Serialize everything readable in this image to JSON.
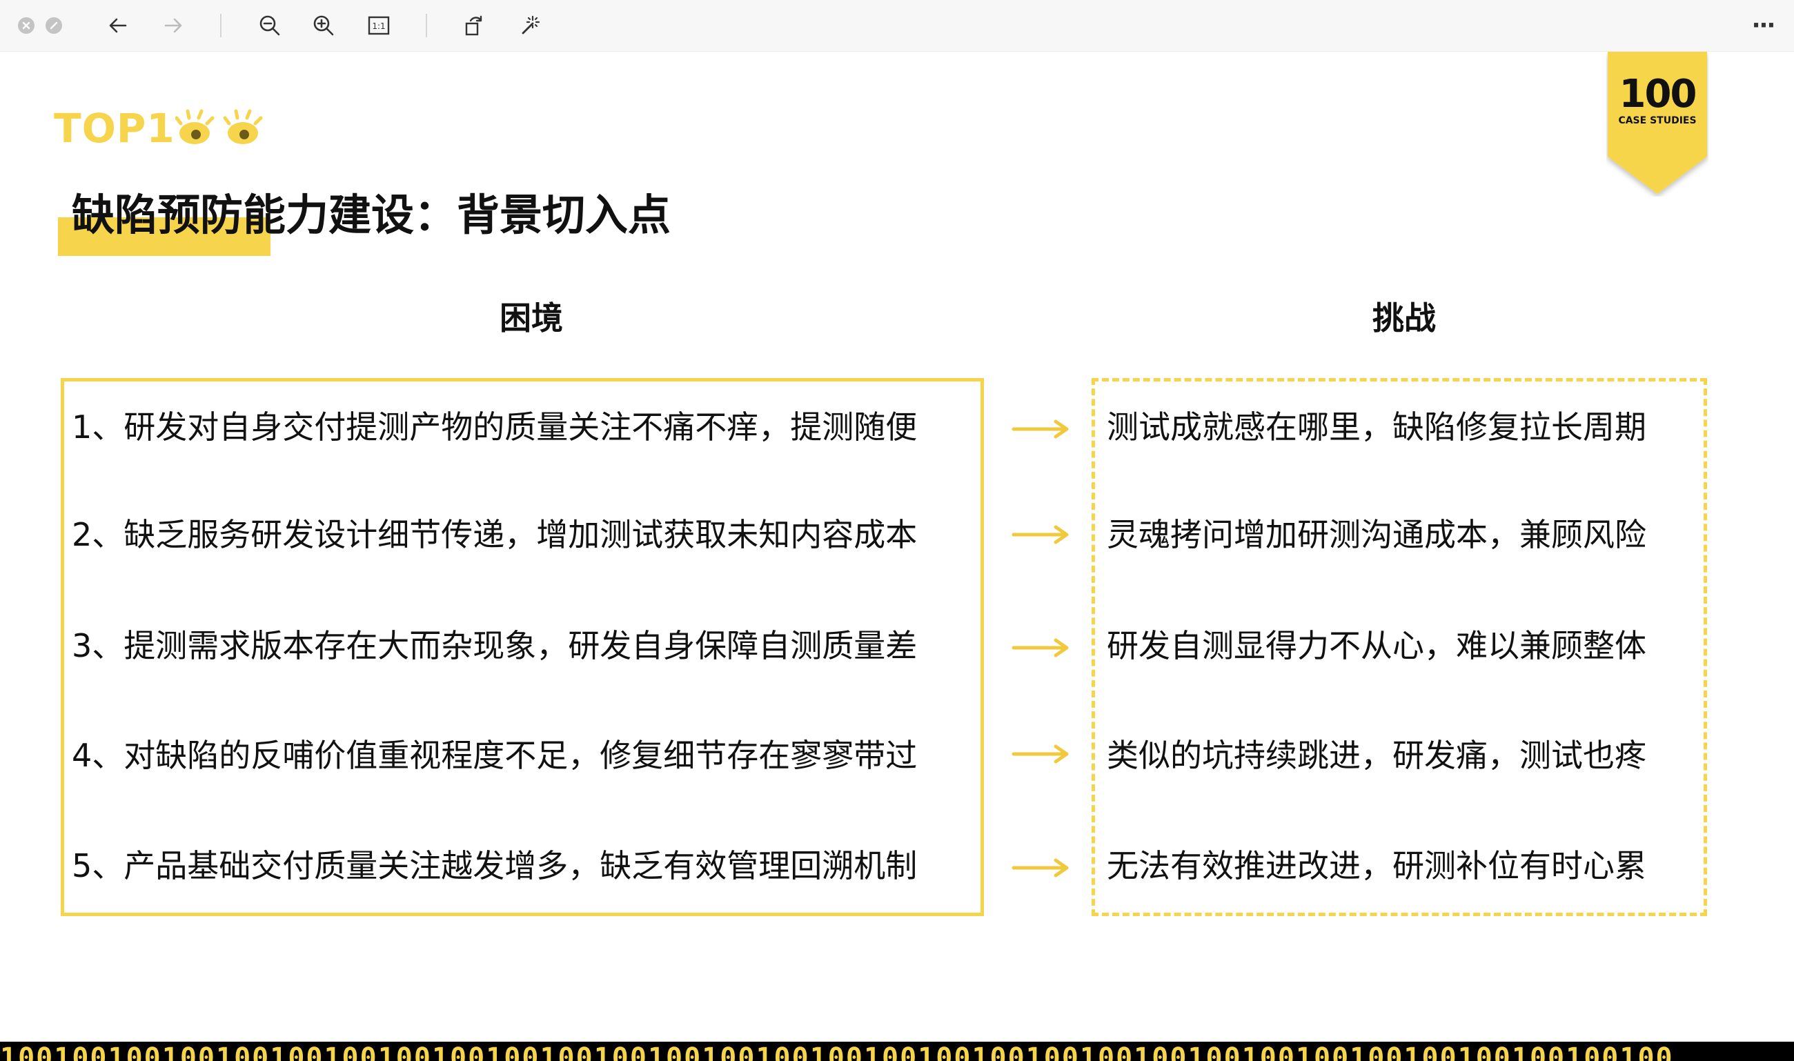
{
  "toolbar": {
    "icons": [
      "close-icon",
      "minimize-icon",
      "back-arrow-icon",
      "forward-arrow-icon",
      "zoom-out-icon",
      "zoom-in-icon",
      "actual-size-icon",
      "rotate-icon",
      "magic-wand-icon",
      "more-icon"
    ],
    "actual_size_glyph": "1:1",
    "more_glyph": "···"
  },
  "slide": {
    "logo_text": "TOP1",
    "badge": {
      "number": "100",
      "subtitle": "CASE STUDIES"
    },
    "title": "缺陷预防能力建设：背景切入点",
    "columns": {
      "left_heading": "困境",
      "right_heading": "挑战"
    },
    "rows": [
      {
        "dilemma": "1、研发对自身交付提测产物的质量关注不痛不痒，提测随便",
        "challenge": "测试成就感在哪里，缺陷修复拉长周期"
      },
      {
        "dilemma": "2、缺乏服务研发设计细节传递，增加测试获取未知内容成本",
        "challenge": "灵魂拷问增加研测沟通成本，兼顾风险"
      },
      {
        "dilemma": "3、提测需求版本存在大而杂现象，研发自身保障自测质量差",
        "challenge": "研发自测显得力不从心，难以兼顾整体"
      },
      {
        "dilemma": "4、对缺陷的反哺价值重视程度不足，修复细节存在寥寥带过",
        "challenge": "类似的坑持续跳进，研发痛，测试也疼"
      },
      {
        "dilemma": "5、产品基础交付质量关注越发增多，缺乏有效管理回溯机制",
        "challenge": "无法有效推进改进，研测补位有时心累"
      }
    ],
    "binary_strip": "100100100100100100100100100100100100100100100100100100100100100100100100100100100100100100100"
  },
  "colors": {
    "accent_yellow": "#f6d54c",
    "text": "#111111",
    "toolbar_bg": "#f7f7f7"
  }
}
